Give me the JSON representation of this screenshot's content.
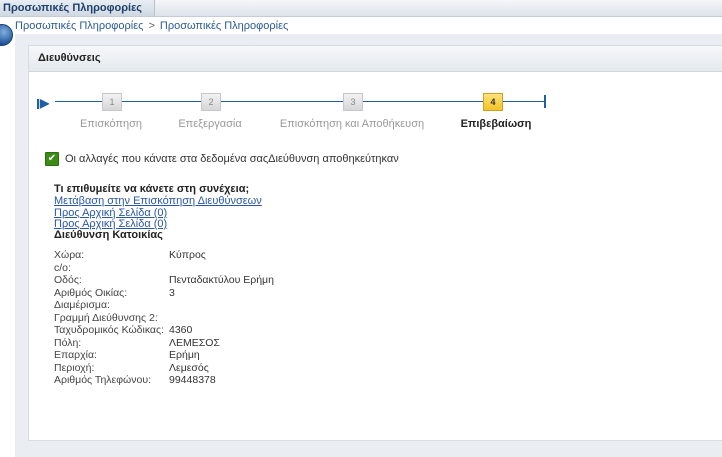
{
  "top_tab": {
    "label": "Προσωπικές Πληροφορίες"
  },
  "breadcrumb": {
    "item1": "Προσωπικές Πληροφορίες",
    "separator": ">",
    "item2": "Προσωπικές Πληροφορίες"
  },
  "panel": {
    "title": "Διευθύνσεις"
  },
  "stepper": {
    "steps": [
      {
        "number": "1",
        "label": "Επισκόπηση"
      },
      {
        "number": "2",
        "label": "Επεξεργασία"
      },
      {
        "number": "3",
        "label": "Επισκόπηση και Αποθήκευση"
      },
      {
        "number": "4",
        "label": "Επιβεβαίωση"
      }
    ],
    "current_step": 4
  },
  "confirmation": {
    "message": "Οι αλλαγές που κάνατε στα δεδομένα σαςΔιεύθυνση αποθηκεύτηκαν"
  },
  "next": {
    "title": "Τι επιθυμείτε να κάνετε στη συνέχεια;",
    "links": [
      "Μετάβαση στην Επισκόπηση Διευθύνσεων",
      "Προς Αρχική Σελίδα (0)",
      "Προς Αρχική Σελίδα (0)"
    ]
  },
  "address": {
    "title": "Διεύθυνση Κατοικίας",
    "fields": [
      {
        "label": "Χώρα:",
        "value": "Κύπρος"
      },
      {
        "label": "c/o:",
        "value": ""
      },
      {
        "label": "Οδός:",
        "value": "Πενταδακτύλου Ερήμη"
      },
      {
        "label": "Αριθμός Οικίας:",
        "value": "3"
      },
      {
        "label": "Διαμέρισμα:",
        "value": ""
      },
      {
        "label": "Γραμμή Διεύθυνσης 2:",
        "value": ""
      },
      {
        "label": "Ταχυδρομικός Κώδικας:",
        "value": "4360"
      },
      {
        "label": "Πόλη:",
        "value": "ΛΕΜΕΣΟΣ"
      },
      {
        "label": "Επαρχία:",
        "value": "Ερήμη"
      },
      {
        "label": "Περιοχή:",
        "value": "Λεμεσός"
      },
      {
        "label": "Αριθμός Τηλεφώνου:",
        "value": "99448378"
      }
    ]
  },
  "colors": {
    "accent": "#1e5fa8",
    "active_step": "#f5c323",
    "success": "#3b8b17",
    "link": "#2857a8"
  }
}
